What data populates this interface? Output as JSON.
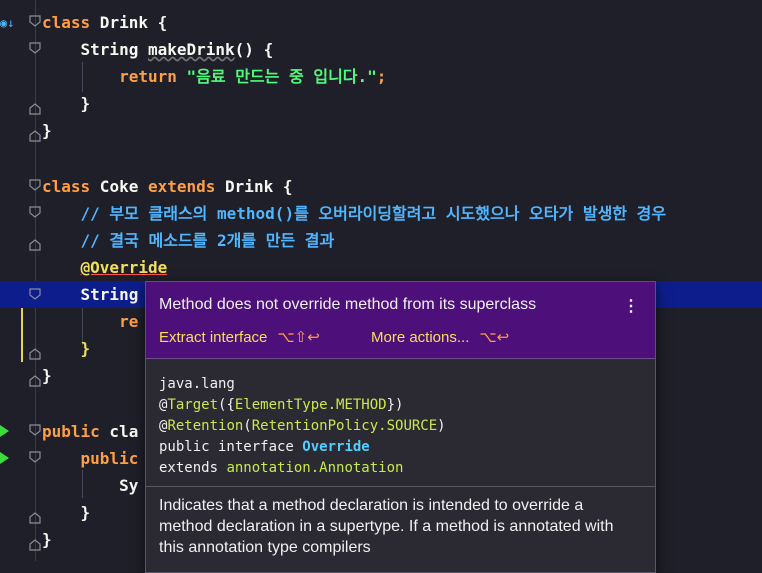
{
  "code": {
    "l1": {
      "kw": "class",
      "rest": " Drink {"
    },
    "l2": {
      "type": "String ",
      "method": "makeDrink",
      "rest": "() {"
    },
    "l3": {
      "kw": "return ",
      "str": "\"음료 만드는 중 입니다.\"",
      "end": ";"
    },
    "l4": "}",
    "l5": "}",
    "l7": {
      "kw": "class",
      "name": " Coke ",
      "kw2": "extends",
      "rest": " Drink {"
    },
    "l8": "// 부모 클래스의 method()를 오버라이딩할려고 시도했으나 오타가 발생한 경우",
    "l9": "// 결국 메소드를 2개를 만든 결과",
    "l10": "@Override",
    "l11": "String",
    "l12": "re",
    "l13": "}",
    "l14": "}",
    "l16": {
      "kw": "public",
      "rest": " cla"
    },
    "l17": {
      "kw": "public"
    },
    "l18": "Sy",
    "l19": "}",
    "l20": "}"
  },
  "popup": {
    "message": "Method does not override method from its superclass",
    "menu_icon": "⋮",
    "action1": "Extract interface",
    "action1_shortcut": "⌥⇧↩",
    "action2": "More actions...",
    "action2_shortcut": "⌥↩",
    "doc_package": "java.lang",
    "doc_target_at": "@",
    "doc_target_name": "Target",
    "doc_target_args_open": "({",
    "doc_target_value": "ElementType.METHOD",
    "doc_target_args_close": "})",
    "doc_retention_at": "@",
    "doc_retention_name": "Retention",
    "doc_retention_open": "(",
    "doc_retention_value": "RetentionPolicy.SOURCE",
    "doc_retention_close": ")",
    "doc_decl_prefix": "public interface ",
    "doc_decl_name": "Override",
    "doc_extends_prefix": "extends ",
    "doc_extends_value": "annotation.Annotation",
    "description": "Indicates that a method declaration is intended to override a method declaration in a supertype. If a method is annotated with this annotation type compilers"
  }
}
